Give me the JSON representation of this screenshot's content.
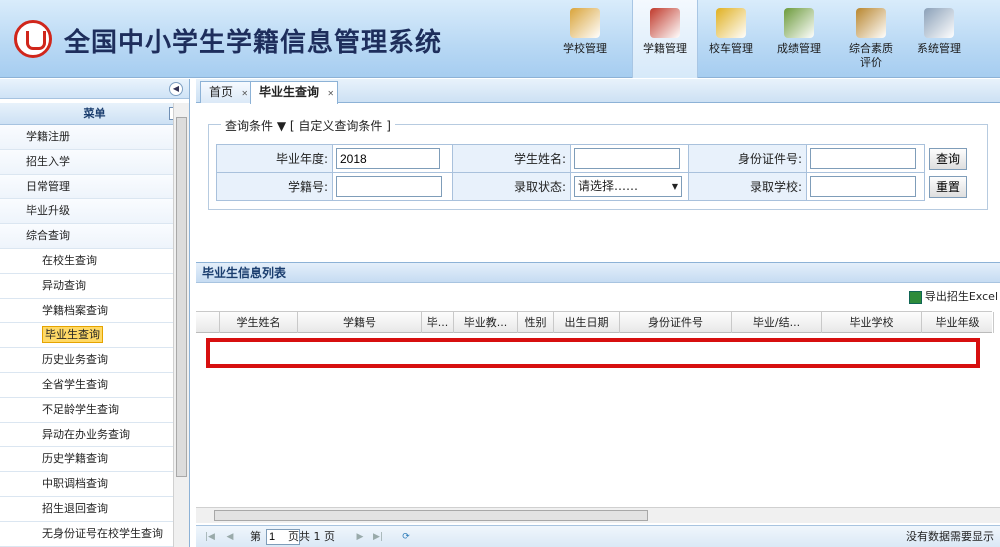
{
  "header": {
    "title": "全国中小学生学籍信息管理系统",
    "nav": [
      {
        "label": "学校管理",
        "icon": "building-icon",
        "color": "#d9a43a"
      },
      {
        "label": "学籍管理",
        "icon": "students-icon",
        "color": "#c0392b",
        "active": true
      },
      {
        "label": "校车管理",
        "icon": "school-bus-icon",
        "color": "#e0b020"
      },
      {
        "label": "成绩管理",
        "icon": "pen-paper-icon",
        "color": "#6b9a3a"
      },
      {
        "label": "综合素质",
        "label2": "评价",
        "icon": "book-icon",
        "color": "#b8862e"
      },
      {
        "label": "系统管理",
        "icon": "gears-icon",
        "color": "#8aa0b8"
      }
    ]
  },
  "sidebar": {
    "menu_title": "菜单",
    "items": [
      {
        "label": "学籍注册",
        "sub": false
      },
      {
        "label": "招生入学",
        "sub": false
      },
      {
        "label": "日常管理",
        "sub": false
      },
      {
        "label": "毕业升级",
        "sub": false
      },
      {
        "label": "综合查询",
        "sub": false
      },
      {
        "label": "在校生查询",
        "sub": true
      },
      {
        "label": "异动查询",
        "sub": true
      },
      {
        "label": "学籍档案查询",
        "sub": true
      },
      {
        "label": "毕业生查询",
        "sub": true,
        "selected": true
      },
      {
        "label": "历史业务查询",
        "sub": true
      },
      {
        "label": "全省学生查询",
        "sub": true
      },
      {
        "label": "不足龄学生查询",
        "sub": true
      },
      {
        "label": "异动在办业务查询",
        "sub": true
      },
      {
        "label": "历史学籍查询",
        "sub": true
      },
      {
        "label": "中职调档查询",
        "sub": true
      },
      {
        "label": "招生退回查询",
        "sub": true
      },
      {
        "label": "无身份证号在校学生查询",
        "sub": true
      }
    ]
  },
  "tabs": [
    {
      "label": "首页"
    },
    {
      "label": "毕业生查询"
    }
  ],
  "query": {
    "legend": "查询条件",
    "custom": "[ 自定义查询条件 ]",
    "grad_year_label": "毕业年度:",
    "grad_year_value": "2018",
    "name_label": "学生姓名:",
    "id_label": "身份证件号:",
    "student_no_label": "学籍号:",
    "admit_status_label": "录取状态:",
    "admit_status_value": "请选择……",
    "admit_school_label": "录取学校:",
    "search_button": "查询",
    "reset_button": "重置"
  },
  "list": {
    "title": "毕业生信息列表",
    "export_label": "导出招生Excel",
    "columns": [
      "学生姓名",
      "学籍号",
      "毕...",
      "毕业教...",
      "性别",
      "出生日期",
      "身份证件号",
      "毕业/结...",
      "毕业学校",
      "毕业年级"
    ]
  },
  "pager": {
    "page_label": "第",
    "page_value": "1",
    "total": "页共  1 页",
    "empty_msg": "没有数据需要显示"
  }
}
